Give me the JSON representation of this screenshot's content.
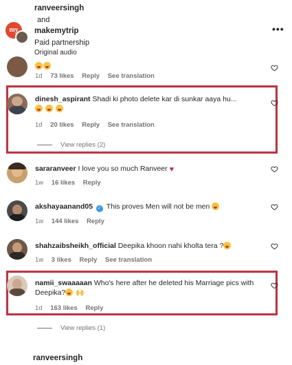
{
  "header": {
    "user1": "ranveersingh",
    "and": "and",
    "user2": "makemytrip",
    "partnership": "Paid partnership",
    "audio": "Original audio"
  },
  "comments": [
    {
      "time": "1d",
      "likes": "73 likes",
      "reply": "Reply",
      "translate": "See translation"
    },
    {
      "user": "dinesh_aspirant",
      "text": "Shadi ki photo delete kar di sunkar aaya hu...",
      "time": "1d",
      "likes": "20 likes",
      "reply": "Reply",
      "translate": "See translation",
      "replies": "View replies (2)"
    },
    {
      "user": "sararanveer",
      "text": "I love you so much Ranveer",
      "time": "1w",
      "likes": "16 likes",
      "reply": "Reply"
    },
    {
      "user": "akshayaanand05",
      "text": "This proves Men will not be men",
      "time": "1w",
      "likes": "144 likes",
      "reply": "Reply"
    },
    {
      "user": "shahzaibsheikh_official",
      "text": "Deepika khoon nahi kholta tera ?",
      "time": "1w",
      "likes": "3 likes",
      "reply": "Reply",
      "translate": "See translation"
    },
    {
      "user": "namii_swaaaaan",
      "text": "Who's here after he deleted his Marriage pics with Deepika?",
      "time": "1d",
      "likes": "163 likes",
      "reply": "Reply",
      "replies": "View replies (1)"
    }
  ],
  "footer": {
    "user": "ranveersingh"
  },
  "colors": {
    "highlight": "#d42a3a",
    "meta": "#737373",
    "text": "#262626"
  }
}
